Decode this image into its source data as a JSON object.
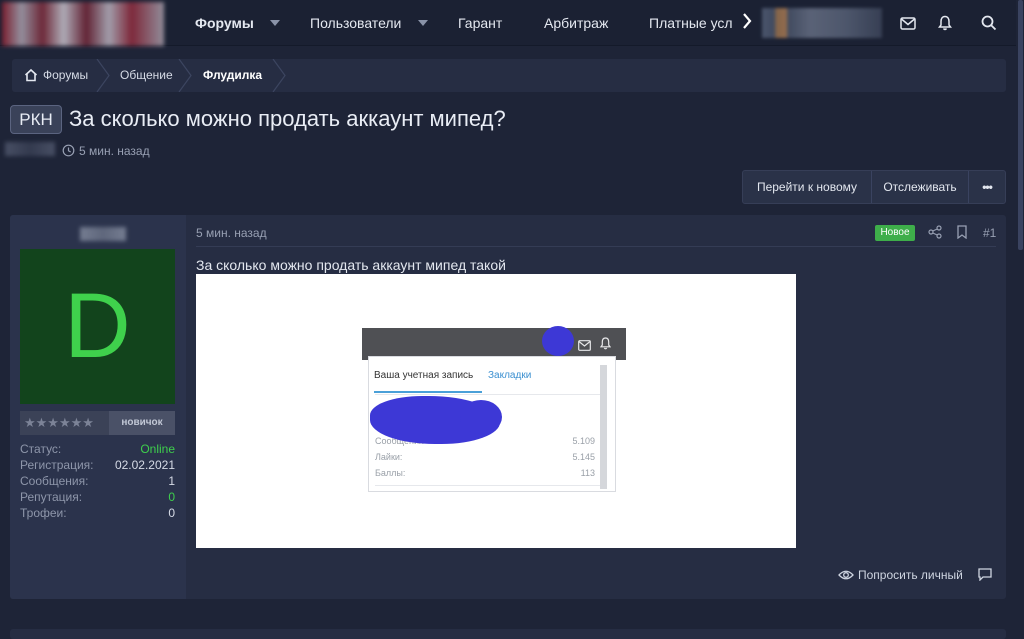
{
  "topnav": {
    "items": [
      {
        "label": "Форумы",
        "bold": true,
        "caret": true
      },
      {
        "label": "Пользователи",
        "bold": false,
        "caret": true
      },
      {
        "label": "Гарант",
        "bold": false,
        "caret": false
      },
      {
        "label": "Арбитраж",
        "bold": false,
        "caret": false
      },
      {
        "label": "Платные усл",
        "bold": false,
        "caret": false
      }
    ],
    "more_icon": "chevron-right-icon",
    "icons": [
      "mail-icon",
      "bell-icon",
      "search-icon"
    ]
  },
  "breadcrumb": {
    "items": [
      "Форумы",
      "Общение",
      "Флудилка"
    ],
    "home_icon": "home-icon"
  },
  "thread": {
    "prefix": "РКН",
    "title": "За сколько можно продать аккаунт мипед?",
    "time": "5 мин. назад"
  },
  "toolbar": {
    "goto_new": "Перейти к новому",
    "watch": "Отслеживать",
    "more": "•••"
  },
  "post": {
    "user": {
      "avatar_letter": "D",
      "rank": "новичок",
      "stats": [
        {
          "label": "Статус:",
          "value": "Online",
          "accent": true
        },
        {
          "label": "Регистрация:",
          "value": "02.02.2021",
          "accent": false
        },
        {
          "label": "Сообщения:",
          "value": "1",
          "accent": false
        },
        {
          "label": "Репутация:",
          "value": "0",
          "accent": true
        },
        {
          "label": "Трофеи:",
          "value": "0",
          "accent": false
        }
      ]
    },
    "time": "5 мин. назад",
    "badge": "Новое",
    "number": "#1",
    "text": "За сколько можно продать аккаунт мипед такой",
    "attachment": {
      "tabs": [
        "Ваша учетная запись",
        "Закладки"
      ],
      "rows": [
        {
          "label": "Сообщения",
          "value": "5.109"
        },
        {
          "label": "Лайки:",
          "value": "5.145"
        },
        {
          "label": "Баллы:",
          "value": "113"
        }
      ]
    },
    "actions": {
      "request": "Попросить личный"
    }
  },
  "colors": {
    "background": "#1e2437",
    "panel": "#262d43",
    "accent_green": "#3ecf4c",
    "avatar_bg": "#12441c"
  }
}
